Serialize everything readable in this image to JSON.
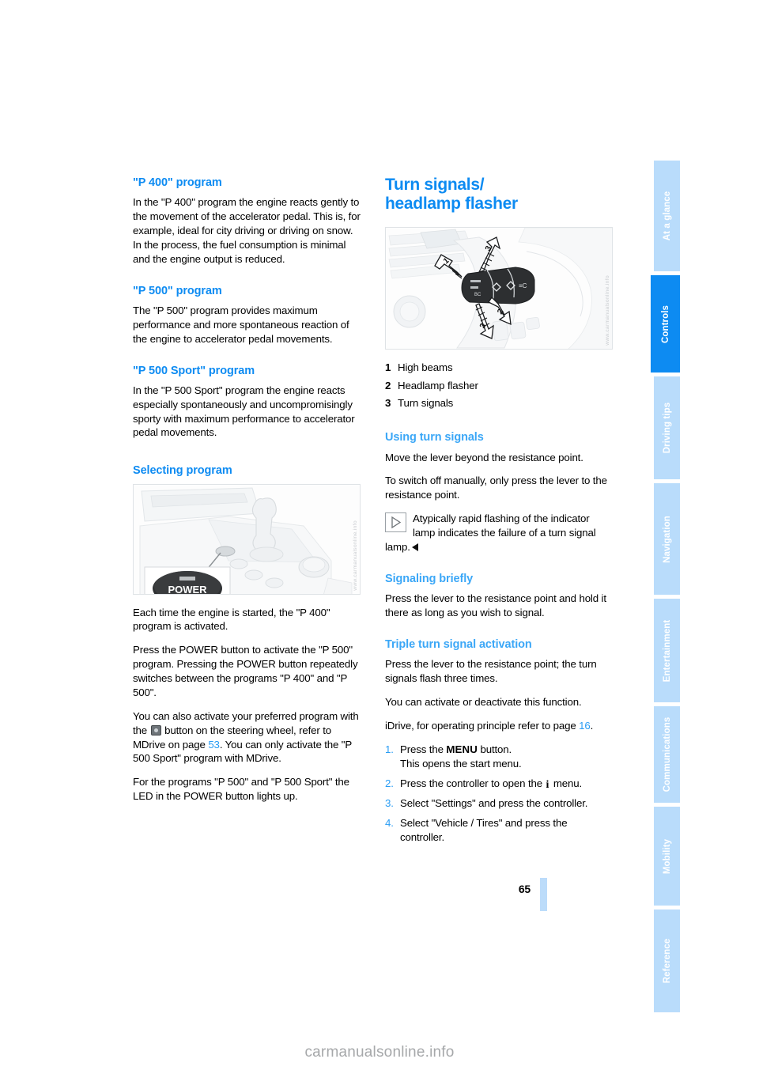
{
  "document": {
    "page_number": "65",
    "watermark": "carmanualsonline.info",
    "figure_watermark": "www.carmanualsonline.info"
  },
  "left_column": {
    "sections": [
      {
        "heading": "\"P 400\" program",
        "paragraphs": [
          "In the \"P 400\" program the engine reacts gently to the movement of the accelerator pedal. This is, for example, ideal for city driving or driving on snow. In the process, the fuel consumption is minimal and the engine output is reduced."
        ]
      },
      {
        "heading": "\"P 500\" program",
        "paragraphs": [
          "The \"P 500\" program provides maximum performance and more spontaneous reaction of the engine to accelerator pedal movements."
        ]
      },
      {
        "heading": "\"P 500 Sport\" program",
        "paragraphs": [
          "In the \"P 500 Sport\" program the engine reacts especially spontaneously and uncompromisingly sporty with maximum performance to accelerator pedal movements."
        ]
      }
    ],
    "selecting_program": {
      "heading": "Selecting program",
      "figure_alt": "Center console with gear selector and POWER button, inset close-up of POWER button",
      "power_button_label": "POWER",
      "paragraph_1": "Each time the engine is started, the \"P 400\" program is activated.",
      "paragraph_2": "Press the POWER button to activate the \"P 500\" program. Pressing the POWER button repeatedly switches between the programs \"P 400\" and \"P 500\".",
      "paragraph_3_part_1": "You can also activate your preferred program with the ",
      "paragraph_3_part_2": " button on the steering wheel, refer to MDrive on page ",
      "paragraph_3_pageref": "53",
      "paragraph_3_part_3": ". You can only activate the \"P 500 Sport\" program with MDrive.",
      "paragraph_4": "For the programs \"P 500\" and \"P 500 Sport\" the LED in the POWER button lights up."
    }
  },
  "right_column": {
    "chapter_title_line_1": "Turn signals/",
    "chapter_title_line_2": "headlamp flasher",
    "figure_alt": "Turn signal / headlamp flasher stalk on steering column with arrows 1, 2, 3",
    "callouts": [
      {
        "number": "1",
        "label": "High beams"
      },
      {
        "number": "2",
        "label": "Headlamp flasher"
      },
      {
        "number": "3",
        "label": "Turn signals"
      }
    ],
    "using_turn_signals": {
      "heading": "Using turn signals",
      "paragraph_1": "Move the lever beyond the resistance point.",
      "paragraph_2": "To switch off manually, only press the lever to the resistance point.",
      "note": "Atypically rapid flashing of the indicator lamp indicates the failure of a turn signal lamp."
    },
    "signaling_briefly": {
      "heading": "Signaling briefly",
      "paragraph_1": "Press the lever to the resistance point and hold it there as long as you wish to signal."
    },
    "triple_turn_signal": {
      "heading": "Triple turn signal activation",
      "paragraph_1": "Press the lever to the resistance point; the turn signals flash three times.",
      "paragraph_2": "You can activate or deactivate this function.",
      "paragraph_3_prefix": "iDrive, for operating principle refer to page ",
      "paragraph_3_pageref": "16",
      "paragraph_3_suffix": ".",
      "steps": [
        {
          "number": "1.",
          "text_before": "Press the ",
          "bold_word": "MENU",
          "text_after": " button.",
          "sub_line": "This opens the start menu."
        },
        {
          "number": "2.",
          "text_before": "Press the controller to open the ",
          "icon": "info-icon",
          "text_after": " menu."
        },
        {
          "number": "3.",
          "text_before": "Select \"Settings\" and press the controller."
        },
        {
          "number": "4.",
          "text_before": "Select \"Vehicle / Tires\" and press the controller."
        }
      ]
    }
  },
  "sidebar": {
    "tabs": [
      {
        "label": "At a glance",
        "active": false
      },
      {
        "label": "Controls",
        "active": true
      },
      {
        "label": "Driving tips",
        "active": false
      },
      {
        "label": "Navigation",
        "active": false
      },
      {
        "label": "Entertainment",
        "active": false
      },
      {
        "label": "Communications",
        "active": false
      },
      {
        "label": "Mobility",
        "active": false
      },
      {
        "label": "Reference",
        "active": false
      }
    ]
  },
  "colors": {
    "accent_blue": "#0d8bf2",
    "sub_heading_blue": "#3ba7f7",
    "tab_inactive": "#b9dcfb",
    "page_marker": "#bcdcfa"
  }
}
